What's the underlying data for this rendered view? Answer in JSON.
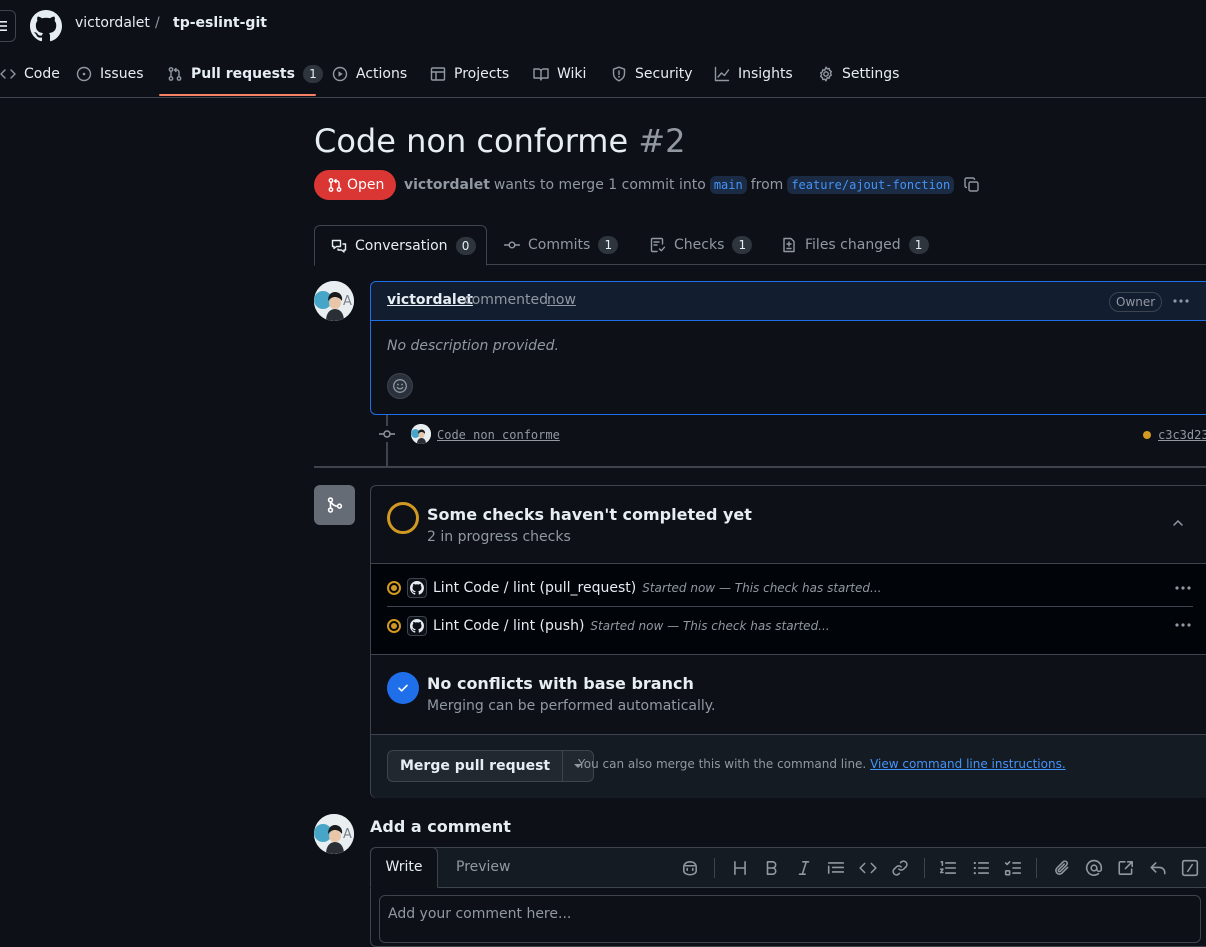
{
  "header": {
    "owner": "victordalet",
    "separator": "/",
    "repo": "tp-eslint-git"
  },
  "repo_nav": [
    {
      "label": "Code",
      "icon": "code-icon"
    },
    {
      "label": "Issues",
      "icon": "issue-icon"
    },
    {
      "label": "Pull requests",
      "icon": "pull-request-icon",
      "count": "1",
      "active": true
    },
    {
      "label": "Actions",
      "icon": "play-icon"
    },
    {
      "label": "Projects",
      "icon": "table-icon"
    },
    {
      "label": "Wiki",
      "icon": "book-icon"
    },
    {
      "label": "Security",
      "icon": "shield-icon"
    },
    {
      "label": "Insights",
      "icon": "graph-icon"
    },
    {
      "label": "Settings",
      "icon": "gear-icon"
    }
  ],
  "pr": {
    "title": "Code non conforme",
    "number": "#2",
    "state": "Open",
    "author": "victordalet",
    "merge_text": "wants to merge 1 commit into",
    "base_branch": "main",
    "from_text": "from",
    "head_branch": "feature/ajout-fonction"
  },
  "pr_tabs": [
    {
      "label": "Conversation",
      "count": "0",
      "icon": "comment-discussion-icon"
    },
    {
      "label": "Commits",
      "count": "1",
      "icon": "commit-icon"
    },
    {
      "label": "Checks",
      "count": "1",
      "icon": "checklist-icon"
    },
    {
      "label": "Files changed",
      "count": "1",
      "icon": "file-diff-icon"
    }
  ],
  "comment": {
    "author": "victordalet",
    "verb": "commented",
    "time": "now",
    "role": "Owner",
    "body": "No description provided."
  },
  "commit": {
    "message": "Code non conforme",
    "sha": "c3c3d23"
  },
  "checks": {
    "title": "Some checks haven't completed yet",
    "subtitle": "2 in progress checks",
    "items": [
      {
        "name": "Lint Code / lint (pull_request)",
        "description": "Started now — This check has started..."
      },
      {
        "name": "Lint Code / lint (push)",
        "description": "Started now — This check has started..."
      }
    ]
  },
  "conflicts": {
    "title": "No conflicts with base branch",
    "subtitle": "Merging can be performed automatically."
  },
  "merge": {
    "button": "Merge pull request",
    "hint": "You can also merge this with the command line.",
    "hint_link": "View command line instructions."
  },
  "add_comment": {
    "title": "Add a comment",
    "write_tab": "Write",
    "preview_tab": "Preview",
    "placeholder": "Add your comment here..."
  },
  "colors": {
    "accent": "#1f6feb",
    "open": "#da3633",
    "pending": "#d29922",
    "nav_underline": "#f78166"
  }
}
